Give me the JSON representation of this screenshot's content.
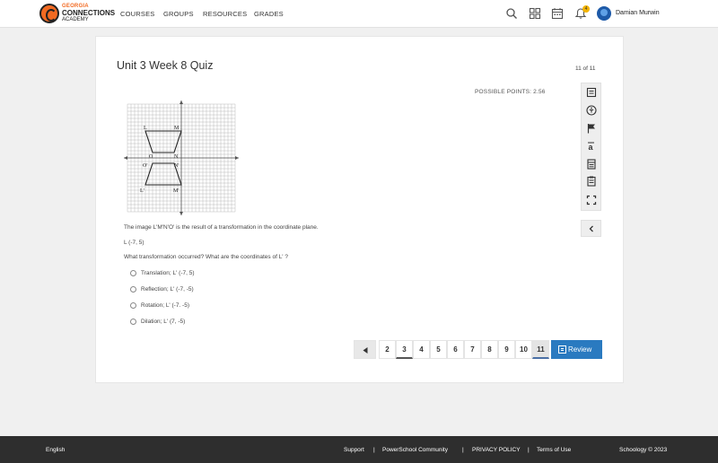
{
  "brand": {
    "line1": "GEORGIA",
    "line2": "CONNECTIONS",
    "line3": "ACADEMY"
  },
  "nav": {
    "courses": "COURSES",
    "groups": "GROUPS",
    "resources": "RESOURCES",
    "grades": "GRADES"
  },
  "notifications": {
    "count": "4"
  },
  "user": {
    "name": "Damian Murwin"
  },
  "quiz": {
    "title": "Unit 3 Week 8 Quiz",
    "page_count": "11 of 11",
    "points": "POSSIBLE POINTS: 2.56",
    "graph_labels": {
      "L": "L",
      "M": "M",
      "O": "O",
      "N": "N",
      "O_prime": "O'",
      "N_prime": "N'",
      "L_prime": "L'",
      "M_prime": "M'"
    },
    "statement": "The image L'M'N'O' is the result of a transformation in the coordinate plane.",
    "point": "L (-7, 5)",
    "question": "What transformation occurred?  What are the coordinates of L' ?",
    "options": [
      "Translation;  L' (-7, 5)",
      "Reflection;  L' (-7, -5)",
      "Rotation;  L' (-7. -5)",
      "Dilation;  L' (7, -5)"
    ]
  },
  "tools": [
    "notes-icon",
    "accessibility-icon",
    "flag-icon",
    "translate-icon",
    "calculator-icon",
    "reference-sheet-icon",
    "fullscreen-icon"
  ],
  "pager": {
    "prev_icon": "caret-left-icon",
    "pages": [
      "2",
      "3",
      "4",
      "5",
      "6",
      "7",
      "8",
      "9",
      "10",
      "11"
    ],
    "current": "11",
    "review_label": "Review"
  },
  "footer": {
    "language": "English",
    "support": "Support",
    "community": "PowerSchool Community",
    "privacy": "PRIVACY POLICY",
    "terms": "Terms of Use",
    "copyright": "Schoology © 2023",
    "separator": "|"
  },
  "colors": {
    "brand_orange": "#f26a21",
    "review_blue": "#2a7ac0",
    "footer_bg": "#2e2e2e"
  }
}
